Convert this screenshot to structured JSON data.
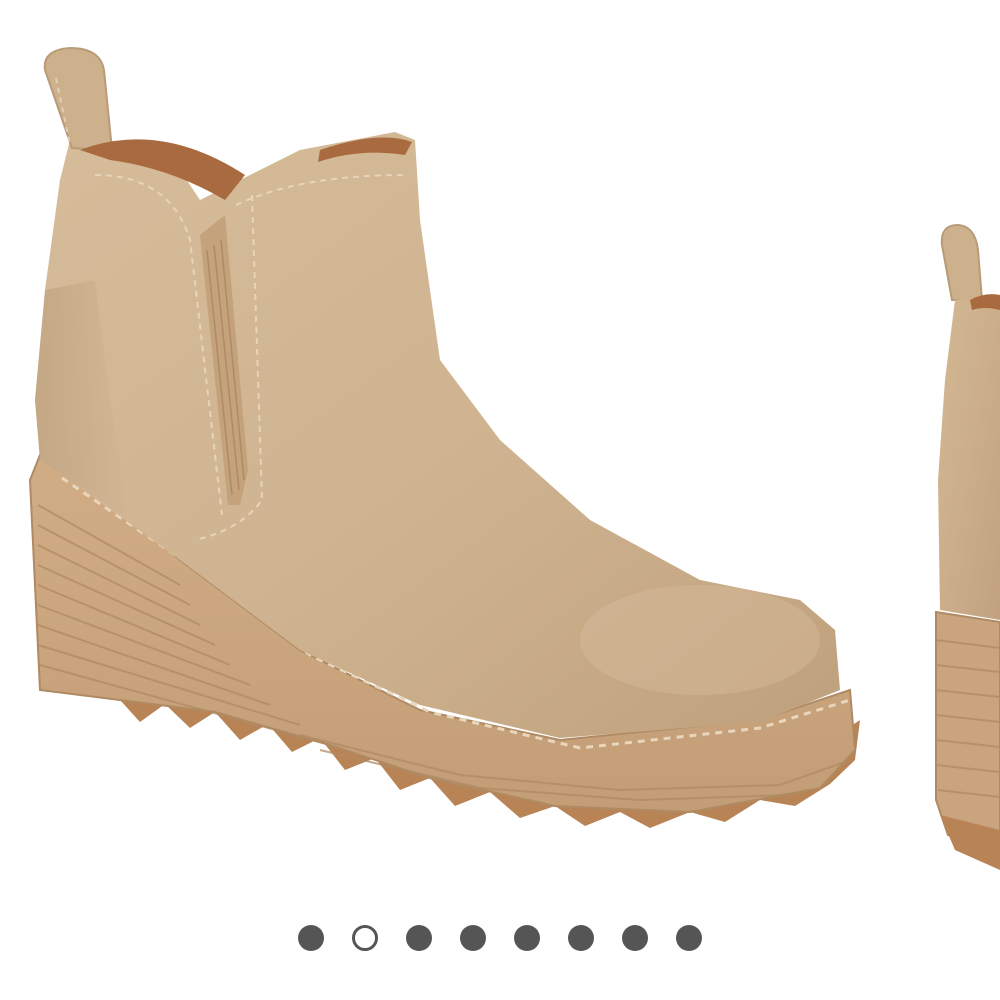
{
  "carousel": {
    "active_index": 1,
    "slide_count": 8,
    "slides": [
      {
        "name": "boot-image-main"
      },
      {
        "name": "boot-image-next-partial"
      }
    ]
  },
  "colors": {
    "background": "#ffffff",
    "suede": "#d0b593",
    "suede_shadow": "#b99b78",
    "suede_highlight": "#dcc4a3",
    "lining": "#a86a3e",
    "elastic": "#c4a27c",
    "wedge": "#c9a47e",
    "wedge_line": "#b08a63",
    "outsole": "#b88455",
    "dot_inactive": "#555555",
    "dot_active_border": "#555555",
    "dot_active_fill": "#ffffff"
  }
}
